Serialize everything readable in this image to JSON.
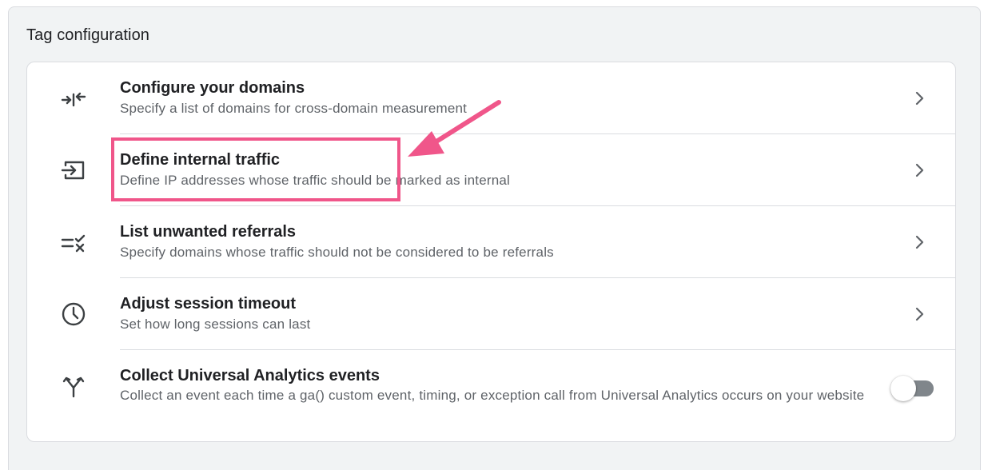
{
  "panel": {
    "title": "Tag configuration"
  },
  "rows": [
    {
      "title": "Configure your domains",
      "description": "Specify a list of domains for cross-domain measurement",
      "icon": "compress-arrows-icon"
    },
    {
      "title": "Define internal traffic",
      "description": "Define IP addresses whose traffic should be marked as internal",
      "icon": "input-arrow-icon"
    },
    {
      "title": "List unwanted referrals",
      "description": "Specify domains whose traffic should not be considered to be referrals",
      "icon": "list-check-x-icon"
    },
    {
      "title": "Adjust session timeout",
      "description": "Set how long sessions can last",
      "icon": "clock-icon"
    },
    {
      "title": "Collect Universal Analytics events",
      "description": "Collect an event each time a ga() custom event, timing, or exception call from Universal Analytics occurs on your website",
      "icon": "merge-arrows-icon",
      "toggle_on": false
    }
  ],
  "annotation": {
    "highlight_color": "#f0568a",
    "arrow_color": "#f0568a"
  },
  "colors": {
    "panel_bg": "#f1f3f4",
    "card_bg": "#ffffff",
    "title_text": "#202124",
    "secondary_text": "#5f6368",
    "divider": "#dadce0",
    "toggle_track_off": "#80868b"
  }
}
